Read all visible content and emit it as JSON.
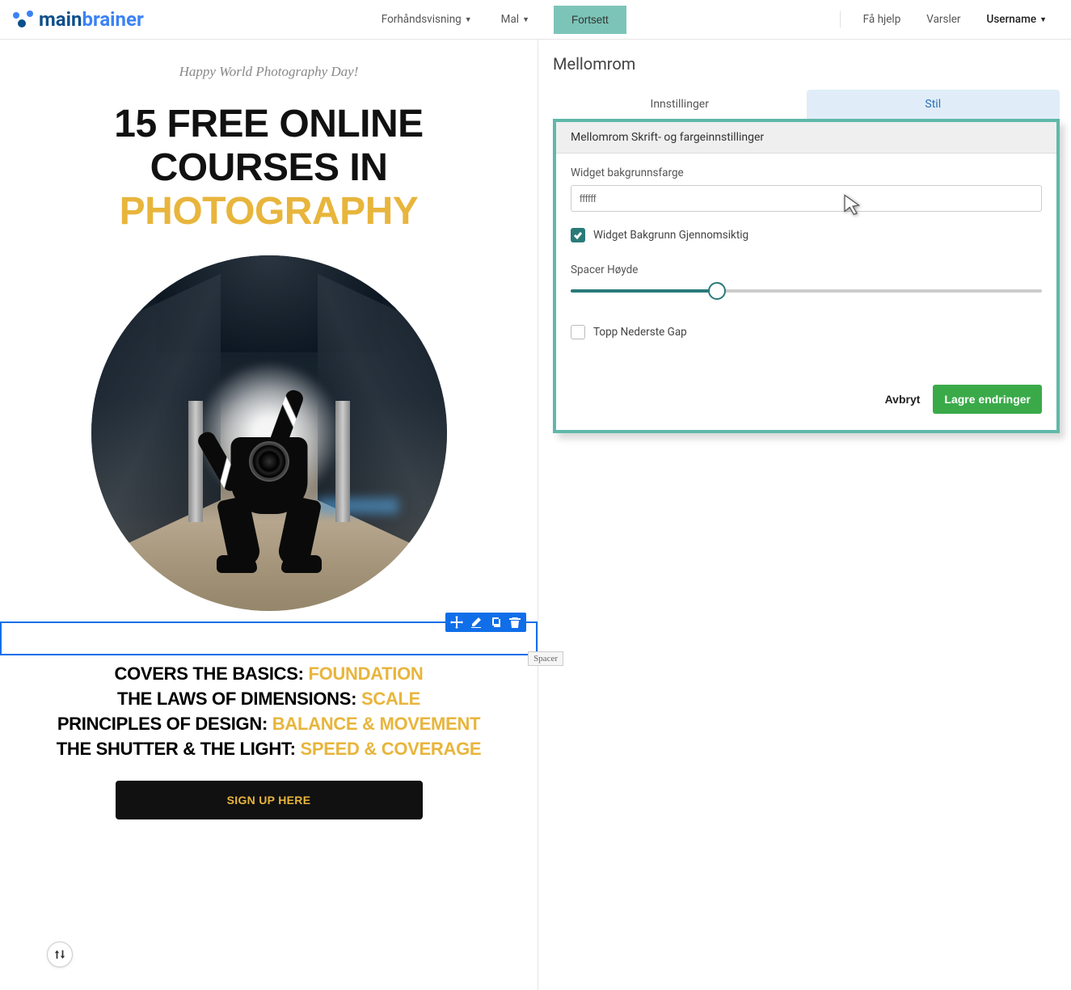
{
  "nav": {
    "brand_main": "main",
    "brand_accent": "brainer",
    "preview": "Forhåndsvisning",
    "template": "Mal",
    "continue": "Fortsett",
    "help": "Få hjelp",
    "alerts": "Varsler",
    "username": "Username"
  },
  "canvas": {
    "subtitle": "Happy World Photography Day!",
    "headline_1": "15 FREE ONLINE COURSES IN",
    "headline_2": "PHOTOGRAPHY",
    "courses": [
      {
        "pre": "COVERS THE BASICS: ",
        "accent": "FOUNDATION"
      },
      {
        "pre": "THE LAWS OF DIMENSIONS: ",
        "accent": "SCALE"
      },
      {
        "pre": "PRINCIPLES OF DESIGN: ",
        "accent": "BALANCE & MOVEMENT"
      },
      {
        "pre": "THE SHUTTER & THE LIGHT: ",
        "accent": "SPEED & COVERAGE"
      }
    ],
    "signup": "SIGN UP HERE",
    "spacer_label": "Spacer"
  },
  "panel": {
    "title": "Mellomrom",
    "tab_settings": "Innstillinger",
    "tab_style": "Stil",
    "section_header": "Mellomrom Skrift- og fargeinnstillinger",
    "bg_color_label": "Widget bakgrunnsfarge",
    "bg_color_value": "ffffff",
    "bg_transparent_label": "Widget Bakgrunn Gjennomsiktig",
    "height_label": "Spacer Høyde",
    "gap_label": "Topp Nederste Gap",
    "cancel": "Avbryt",
    "save": "Lagre endringer"
  }
}
